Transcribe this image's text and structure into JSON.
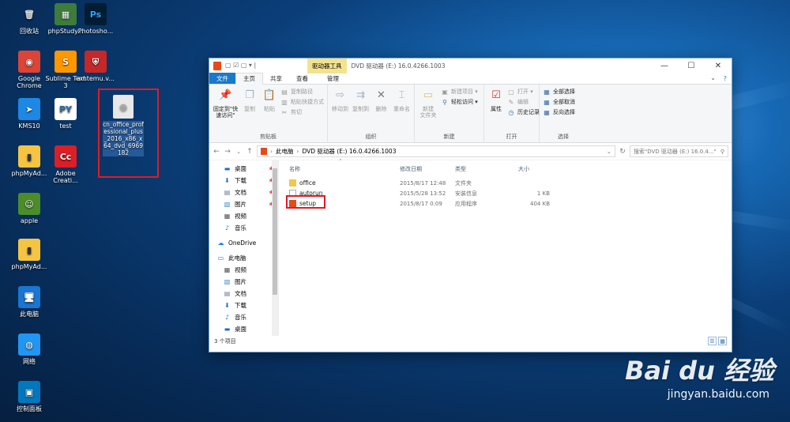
{
  "desktop": {
    "icons": [
      {
        "label": "回收站",
        "glyph": "🗑",
        "color": "#d9d9d9",
        "bg": "transparent"
      },
      {
        "label": "phpStudy...",
        "glyph": "▦",
        "color": "#fff",
        "bg": "#3d7c3a"
      },
      {
        "label": "Photosho...",
        "glyph": "Ps",
        "color": "#31a8ff",
        "bg": "#001d34"
      },
      {
        "label": "Google Chrome",
        "glyph": "◉",
        "color": "#fff",
        "bg": "#db4437"
      },
      {
        "label": "Sublime Text 3",
        "glyph": "S",
        "color": "#fff",
        "bg": "#ff9800"
      },
      {
        "label": "amtemu.v...",
        "glyph": "⛨",
        "color": "#fff",
        "bg": "#c62828"
      },
      {
        "label": "KMS10",
        "glyph": "➤",
        "color": "#fff",
        "bg": "#1e88e5"
      },
      {
        "label": "test",
        "glyph": "PY",
        "color": "#306998",
        "bg": "#fff"
      },
      {
        "label": "phpMyAd...",
        "glyph": "▮",
        "color": "#333",
        "bg": "#f5c542"
      },
      {
        "label": "Adobe Creati...",
        "glyph": "Cc",
        "color": "#fff",
        "bg": "#da1f26"
      },
      {
        "label": "apple",
        "glyph": "☺",
        "color": "#fff",
        "bg": "#4c8c2b"
      },
      {
        "label": "phpMyAd...",
        "glyph": "▮",
        "color": "#333",
        "bg": "#f5c542"
      },
      {
        "label": "此电脑",
        "glyph": "🖥",
        "color": "#fff",
        "bg": "#1976d2"
      },
      {
        "label": "网络",
        "glyph": "◍",
        "color": "#fff",
        "bg": "#2196f3"
      },
      {
        "label": "控制面板",
        "glyph": "▣",
        "color": "#fff",
        "bg": "#0277bd"
      }
    ],
    "iso_label": "cn_office_professional_plus_2016_x86_x64_dvd_6969182"
  },
  "window": {
    "quick_access": "▢ ☑ ▢ ▾ |",
    "context_tab": "驱动器工具",
    "title": "DVD 驱动器 (E:) 16.0.4266.1003",
    "controls": {
      "minimize": "—",
      "maximize": "☐",
      "close": "✕"
    }
  },
  "ribbon_tabs": [
    "文件",
    "主页",
    "共享",
    "查看",
    "管理"
  ],
  "ribbon": {
    "clipboard": {
      "pin": "固定到\"快速访问\"",
      "copy": "复制",
      "paste": "粘贴",
      "copy_path": "复制路径",
      "paste_shortcut": "粘贴快捷方式",
      "cut": "剪切",
      "label": "剪贴板"
    },
    "organize": {
      "move_to": "移动到",
      "copy_to": "复制到",
      "delete": "删除",
      "rename": "重命名",
      "label": "组织"
    },
    "new": {
      "new_folder": "新建\n文件夹",
      "new_item": "新建项目 ▾",
      "easy_access": "轻松访问 ▾",
      "label": "新建"
    },
    "open": {
      "properties": "属性",
      "open": "打开 ▾",
      "edit": "编辑",
      "history": "历史记录",
      "label": "打开"
    },
    "select": {
      "select_all": "全部选择",
      "select_none": "全部取消",
      "invert": "反向选择",
      "label": "选择"
    }
  },
  "address": {
    "path_root": "此电脑",
    "path_drive": "DVD 驱动器 (E:) 16.0.4266.1003",
    "search_placeholder": "搜索\"DVD 驱动器 (E:) 16.0.4...\""
  },
  "nav_pane": {
    "quick": [
      {
        "label": "桌面",
        "icon": "▬",
        "color": "#1e6fc1",
        "pinned": true
      },
      {
        "label": "下载",
        "icon": "⬇",
        "color": "#1e6fc1",
        "pinned": true
      },
      {
        "label": "文档",
        "icon": "▤",
        "color": "#6a7d92",
        "pinned": true
      },
      {
        "label": "图片",
        "icon": "▧",
        "color": "#3a8fd0",
        "pinned": true
      },
      {
        "label": "视频",
        "icon": "▦",
        "color": "#555",
        "pinned": false
      },
      {
        "label": "音乐",
        "icon": "♪",
        "color": "#1e6fc1",
        "pinned": false
      }
    ],
    "onedrive": "OneDrive",
    "this_pc": "此电脑",
    "pc_items": [
      {
        "label": "视频",
        "icon": "▦",
        "color": "#555"
      },
      {
        "label": "图片",
        "icon": "▧",
        "color": "#3a8fd0"
      },
      {
        "label": "文档",
        "icon": "▤",
        "color": "#6a7d92"
      },
      {
        "label": "下载",
        "icon": "⬇",
        "color": "#1e6fc1"
      },
      {
        "label": "音乐",
        "icon": "♪",
        "color": "#1e6fc1"
      },
      {
        "label": "桌面",
        "icon": "▬",
        "color": "#1e6fc1"
      },
      {
        "label": "本地磁盘 (C:)",
        "icon": "▭",
        "color": "#555"
      },
      {
        "label": "DVD 驱动器 (E:)",
        "icon": "▮",
        "color": "#e64a19",
        "selected": true
      },
      {
        "label": "...",
        "icon": "▭",
        "color": "#e0b640"
      }
    ]
  },
  "columns": {
    "name": "名称",
    "date": "修改日期",
    "type": "类型",
    "size": "大小"
  },
  "files": [
    {
      "name": "office",
      "date": "2015/8/17 12:48",
      "type": "文件夹",
      "size": "",
      "icon": "folder"
    },
    {
      "name": "autorun",
      "date": "2015/5/28 13:52",
      "type": "安装信息",
      "size": "1 KB",
      "icon": "ini"
    },
    {
      "name": "setup",
      "date": "2015/8/17 0:09",
      "type": "应用程序",
      "size": "404 KB",
      "icon": "office"
    }
  ],
  "status": {
    "count": "3 个项目"
  },
  "colors": {
    "accent": "#1979ca",
    "highlight": "#e01b24",
    "selected": "#cce8ff"
  },
  "watermark": {
    "brand": "Bai du 经验",
    "url": "jingyan.baidu.com"
  }
}
